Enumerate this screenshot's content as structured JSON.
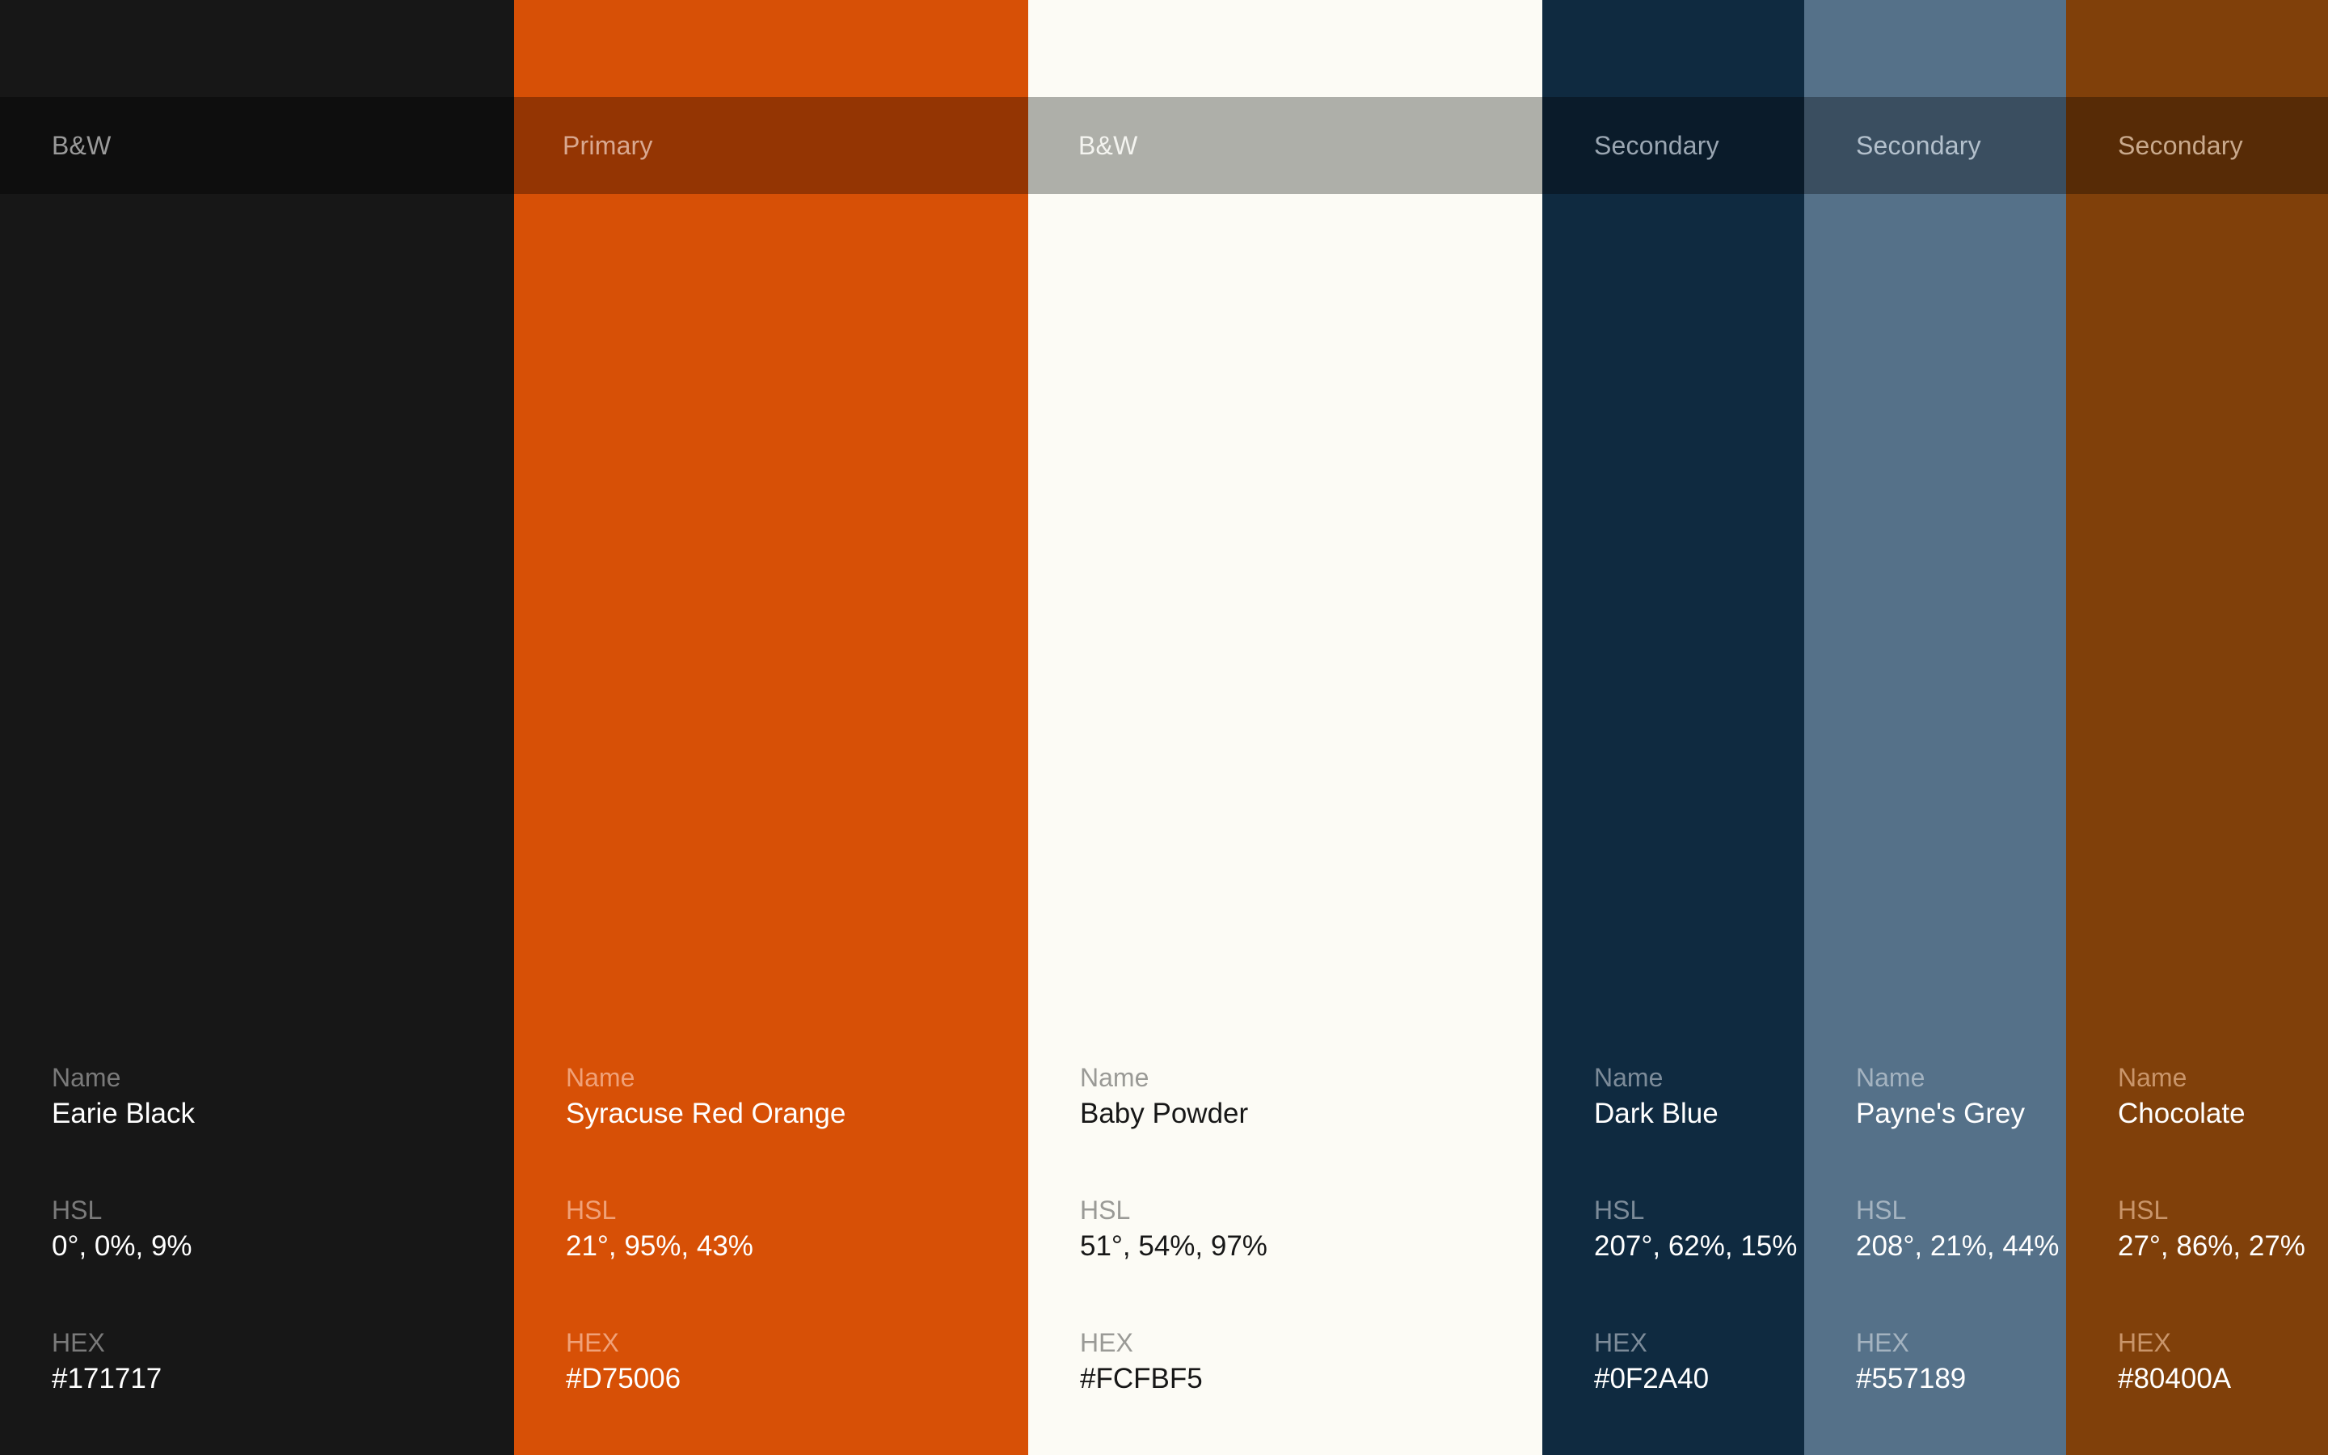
{
  "palette": {
    "labels": {
      "name": "Name",
      "hsl": "HSL",
      "hex": "HEX"
    },
    "swatches": [
      {
        "category": "B&W",
        "name": "Earie Black",
        "hsl": "0°, 0%, 9%",
        "hex": "#171717",
        "color": "#171717",
        "band": "#0E0E0E",
        "bandText": "#9A9A9A",
        "labelColor": "#7A7A7A",
        "valueColor": "#FFFFFF"
      },
      {
        "category": "Primary",
        "name": "Syracuse Red Orange",
        "hsl": "21°, 95%, 43%",
        "hex": "#D75006",
        "color": "#D75006",
        "band": "#943503",
        "bandText": "#D9A890",
        "labelColor": "#F0A178",
        "valueColor": "#FFFFFF"
      },
      {
        "category": "B&W",
        "name": "Baby Powder",
        "hsl": "51°, 54%, 97%",
        "hex": "#FCFBF5",
        "color": "#FCFBF5",
        "band": "#AEAFA9",
        "bandText": "#F4F4F0",
        "labelColor": "#9A9A96",
        "valueColor": "#171717"
      },
      {
        "category": "Secondary",
        "name": "Dark Blue",
        "hsl": "207°, 62%, 15%",
        "hex": "#0F2A40",
        "color": "#0F2A40",
        "band": "#0A1B2A",
        "bandText": "#9AA6B2",
        "labelColor": "#7C8B99",
        "valueColor": "#FFFFFF"
      },
      {
        "category": "Secondary",
        "name": "Payne's Grey",
        "hsl": "208°, 21%, 44%",
        "hex": "#557189",
        "color": "#557189",
        "band": "#3A4E60",
        "bandText": "#B3C0CC",
        "labelColor": "#A4B3C0",
        "valueColor": "#FFFFFF"
      },
      {
        "category": "Secondary",
        "name": "Chocolate",
        "hsl": "27°, 86%, 27%",
        "hex": "#80400A",
        "color": "#80400A",
        "band": "#572B06",
        "bandText": "#C9A98C",
        "labelColor": "#C9956A",
        "valueColor": "#FFFFFF"
      }
    ]
  }
}
